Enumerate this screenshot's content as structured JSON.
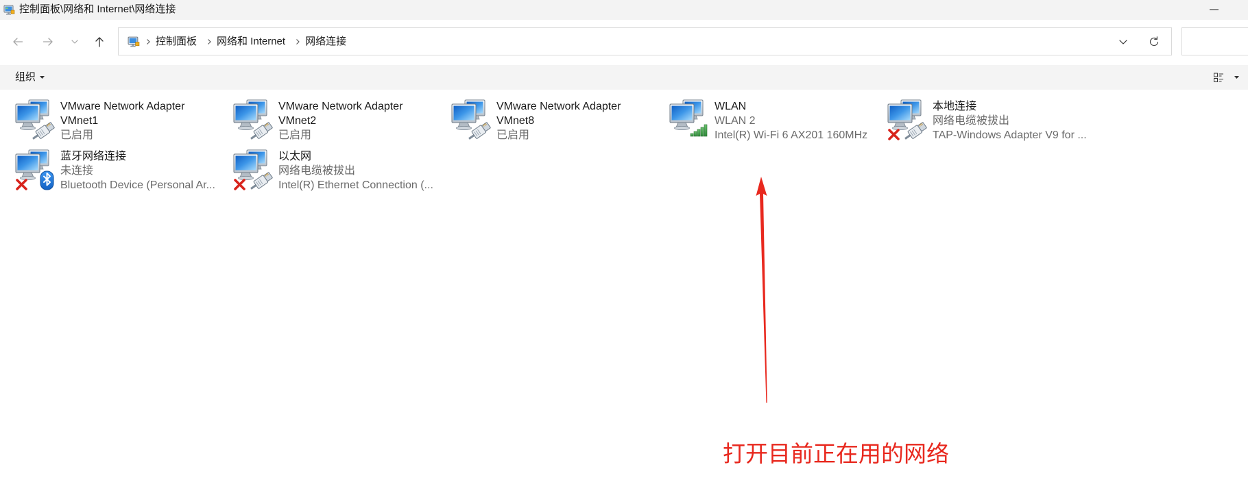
{
  "window": {
    "title": "控制面板\\网络和 Internet\\网络连接",
    "icon": "control-panel-icon",
    "minimize_icon": "minimize-icon"
  },
  "navigation": {
    "back_icon": "arrow-left-icon",
    "forward_icon": "arrow-right-icon",
    "recent_icon": "chevron-down-icon",
    "up_icon": "arrow-up-icon"
  },
  "address_bar": {
    "location_icon": "control-panel-icon",
    "separator_icon": "chevron-right-icon",
    "breadcrumbs": [
      "控制面板",
      "网络和 Internet",
      "网络连接"
    ],
    "history_icon": "chevron-down-icon",
    "refresh_icon": "refresh-icon"
  },
  "search": {
    "value": ""
  },
  "toolbar": {
    "organize_label": "组织",
    "organize_icon": "caret-down-icon",
    "view_icon": "change-view-icon",
    "view_dropdown_icon": "caret-down-icon"
  },
  "connections": [
    {
      "name": "VMware Network Adapter VMnet1",
      "status": "已启用",
      "icon": "network-adapter-icon",
      "badge": "ethernet-plug-icon",
      "disconnected": false
    },
    {
      "name": "VMware Network Adapter VMnet2",
      "status": "已启用",
      "icon": "network-adapter-icon",
      "badge": "ethernet-plug-icon",
      "disconnected": false
    },
    {
      "name": "VMware Network Adapter VMnet8",
      "status": "已启用",
      "icon": "network-adapter-icon",
      "badge": "ethernet-plug-icon",
      "disconnected": false
    },
    {
      "name": "WLAN",
      "status": "WLAN 2",
      "device": "Intel(R) Wi-Fi 6 AX201 160MHz",
      "icon": "network-adapter-icon",
      "badge": "wifi-signal-icon",
      "disconnected": false
    },
    {
      "name": "本地连接",
      "status": "网络电缆被拔出",
      "device": "TAP-Windows Adapter V9 for ...",
      "icon": "network-adapter-icon",
      "badge": "ethernet-plug-icon",
      "disconnected": true
    },
    {
      "name": "蓝牙网络连接",
      "status": "未连接",
      "device": "Bluetooth Device (Personal Ar...",
      "icon": "network-adapter-icon",
      "badge": "bluetooth-icon",
      "disconnected": true
    },
    {
      "name": "以太网",
      "status": "网络电缆被拔出",
      "device": "Intel(R) Ethernet Connection (...",
      "icon": "network-adapter-icon",
      "badge": "ethernet-plug-icon",
      "disconnected": true
    }
  ],
  "annotation": {
    "text": "打开目前正在用的网络",
    "color": "#e8281e",
    "arrow_icon": "arrow-up-annotation"
  },
  "colors": {
    "titlebar_bg": "#f3f3f3",
    "toolbar_bg": "#f4f4f4",
    "secondary_text": "#6b6b6b",
    "wifi_signal": "#3d9a47",
    "disconnected_mark": "#d8241c",
    "bluetooth": "#1a73d9"
  }
}
